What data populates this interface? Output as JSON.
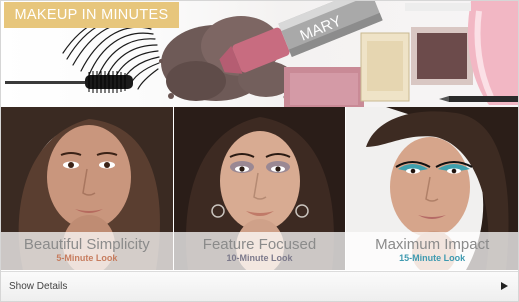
{
  "banner": {
    "title": "MAKEUP IN MINUTES",
    "lipstick_brand": "MARY",
    "accent_color": "#e7c67c"
  },
  "looks": [
    {
      "name": "Beautiful Simplicity",
      "duration": "5-Minute Look",
      "color": "#c77d5f"
    },
    {
      "name": "Feature Focused",
      "duration": "10-Minute Look",
      "color": "#7d7a8c"
    },
    {
      "name": "Maximum Impact",
      "duration": "15-Minute Look",
      "color": "#3f9ab0"
    }
  ],
  "footer": {
    "label": "Show Details",
    "icon": "play-arrow-icon"
  }
}
